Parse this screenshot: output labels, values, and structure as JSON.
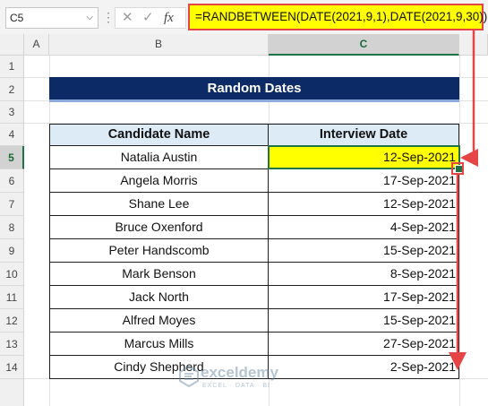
{
  "name_box": "C5",
  "fx_icons": {
    "cancel": "✕",
    "enter": "✓",
    "fx": "fx"
  },
  "formula": "=RANDBETWEEN(DATE(2021,9,1),DATE(2021,9,30))",
  "columns": [
    "A",
    "B",
    "C"
  ],
  "rows": [
    "1",
    "2",
    "3",
    "4",
    "5",
    "6",
    "7",
    "8",
    "9",
    "10",
    "11",
    "12",
    "13",
    "14"
  ],
  "table": {
    "title": "Random Dates",
    "headers": [
      "Candidate Name",
      "Interview Date"
    ],
    "rows": [
      {
        "name": "Natalia Austin",
        "date": "12-Sep-2021"
      },
      {
        "name": "Angela Morris",
        "date": "17-Sep-2021"
      },
      {
        "name": "Shane Lee",
        "date": "12-Sep-2021"
      },
      {
        "name": "Bruce Oxenford",
        "date": "4-Sep-2021"
      },
      {
        "name": "Peter Handscomb",
        "date": "15-Sep-2021"
      },
      {
        "name": "Mark Benson",
        "date": "8-Sep-2021"
      },
      {
        "name": "Jack North",
        "date": "17-Sep-2021"
      },
      {
        "name": "Alfred Moyes",
        "date": "15-Sep-2021"
      },
      {
        "name": "Marcus Mills",
        "date": "27-Sep-2021"
      },
      {
        "name": "Cindy Shepherd",
        "date": "2-Sep-2021"
      }
    ]
  },
  "watermark": {
    "name": "exceldemy",
    "tagline": "EXCEL · DATA · BI"
  },
  "colors": {
    "title_bg": "#0b2a66",
    "header_bg": "#ddebf7",
    "highlight": "#ffff00",
    "arrow": "#e64545",
    "excel_green": "#217346"
  }
}
